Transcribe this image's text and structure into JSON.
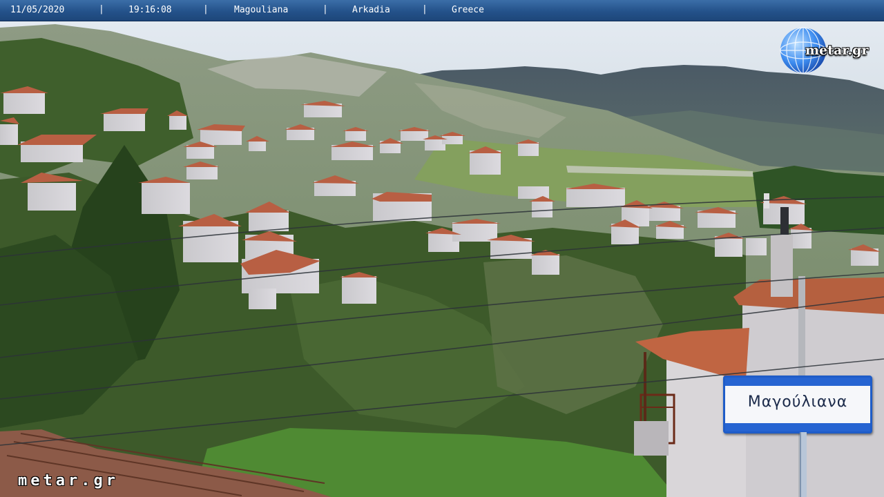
{
  "info_bar": {
    "date": "11/05/2020",
    "time": "19:16:08",
    "village": "Magouliana",
    "region": "Arkadia",
    "country": "Greece",
    "separator": "|"
  },
  "brand": {
    "logo_text": "metar.gr",
    "logo_icon": "globe-icon"
  },
  "watermark": "metar.gr",
  "sign": {
    "text": "Μαγούλιανα"
  },
  "colors": {
    "bar_blue": "#24528a",
    "sign_blue": "#2664d2",
    "roof_terracotta": "#c0694a"
  }
}
